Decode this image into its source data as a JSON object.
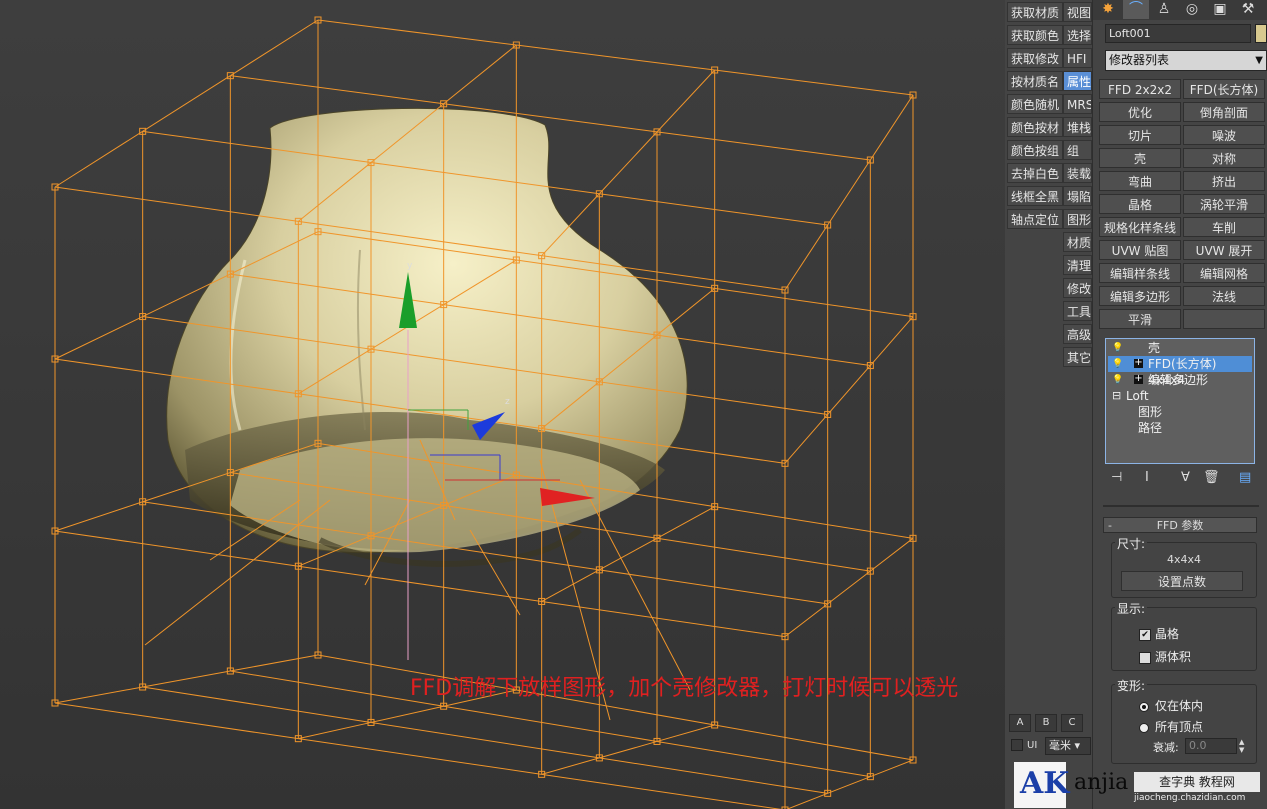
{
  "script_buttons_left": [
    "获取材质",
    "获取颜色",
    "获取修改",
    "按材质名",
    "颜色随机",
    "颜色按材",
    "颜色按组",
    "去掉白色",
    "线框全黑",
    "轴点定位"
  ],
  "script_buttons_right": [
    "视图",
    "选择",
    "HFI",
    "属性",
    "MRS",
    "堆栈",
    "组",
    "装载",
    "塌陷",
    "图形",
    "材质",
    "清理",
    "修改",
    "工具",
    "高级",
    "其它"
  ],
  "script_highlighted": "属性",
  "abc_tabs": [
    "A",
    "B",
    "C"
  ],
  "ui_label": "UI",
  "unit_select": "毫米",
  "annotation": "FFD调解下放样图形，加个壳修改器，打灯时候可以透光",
  "axis_labels": {
    "y": "y",
    "z": "z"
  },
  "panel": {
    "object_name": "Loft001",
    "modifier_list": "修改器列表",
    "modifier_buttons": [
      [
        "FFD 2x2x2",
        "FFD(长方体)"
      ],
      [
        "优化",
        "倒角剖面"
      ],
      [
        "切片",
        "噪波"
      ],
      [
        "壳",
        "对称"
      ],
      [
        "弯曲",
        "挤出"
      ],
      [
        "晶格",
        "涡轮平滑"
      ],
      [
        "规格化样条线",
        "车削"
      ],
      [
        "UVW 贴图",
        "UVW 展开"
      ],
      [
        "编辑样条线",
        "编辑网格"
      ],
      [
        "编辑多边形",
        "法线"
      ],
      [
        "平滑",
        ""
      ]
    ],
    "stack": [
      {
        "label": "壳",
        "icon": "bulb",
        "plus": false,
        "indent": 0,
        "selected": false
      },
      {
        "label": "FFD(长方体) 4x4x4",
        "icon": "bulb",
        "plus": true,
        "indent": 0,
        "selected": true
      },
      {
        "label": "编辑多边形",
        "icon": "bulb",
        "plus": true,
        "indent": 0,
        "selected": false
      },
      {
        "label": "Loft",
        "icon": "",
        "plus": false,
        "indent": 1,
        "selected": false
      },
      {
        "label": "图形",
        "icon": "",
        "plus": false,
        "indent": 2,
        "selected": false
      },
      {
        "label": "路径",
        "icon": "",
        "plus": false,
        "indent": 2,
        "selected": false
      }
    ],
    "rollout_title": "FFD 参数",
    "dims_group": "尺寸:",
    "dims_value": "4x4x4",
    "set_points": "设置点数",
    "display_group": "显示:",
    "lattice_label": "晶格",
    "lattice_checked": true,
    "source_label": "源体积",
    "source_checked": false,
    "deform_group": "变形:",
    "only_in_volume": "仅在体内",
    "all_vertices": "所有顶点",
    "falloff_label": "衰减:",
    "falloff_value": "0.0"
  },
  "watermark": {
    "logo": "AK",
    "text": "查字典 教程网",
    "sub": "jiaocheng.chazidian.com",
    "brand": "anjia"
  },
  "colors": {
    "lattice": "#f0952a",
    "selection": "#4f8ed6",
    "annotation": "#e02020",
    "object": "#d8cfa0"
  }
}
